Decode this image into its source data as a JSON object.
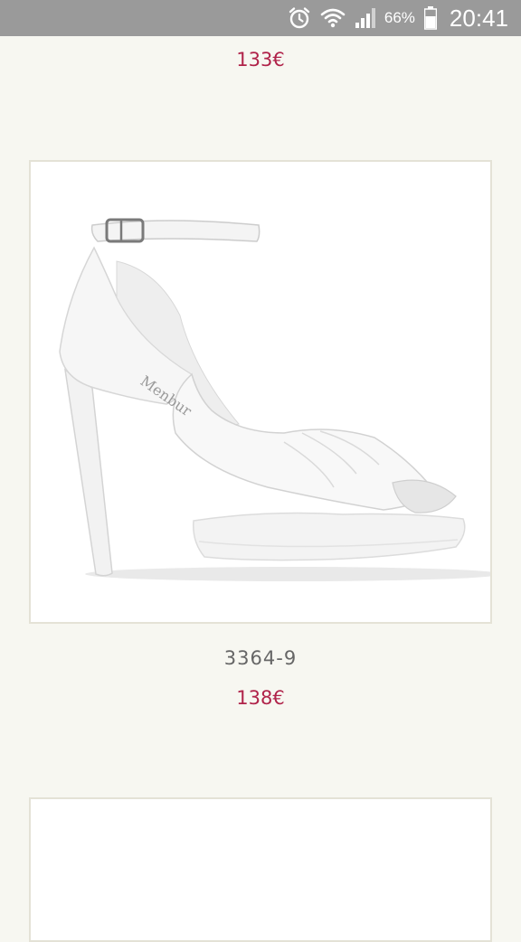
{
  "status_bar": {
    "battery_percent": "66%",
    "time": "20:41",
    "icons": [
      "alarm-icon",
      "wifi-icon",
      "signal-icon",
      "battery-icon"
    ]
  },
  "products": [
    {
      "price": "133€"
    },
    {
      "code": "3364-9",
      "price": "138€",
      "image": "white-high-heel-sandal",
      "brand_mark": "Menbur"
    }
  ],
  "colors": {
    "price": "#b0234a",
    "background": "#f7f7f1",
    "status_bar": "#9a9a9a"
  }
}
